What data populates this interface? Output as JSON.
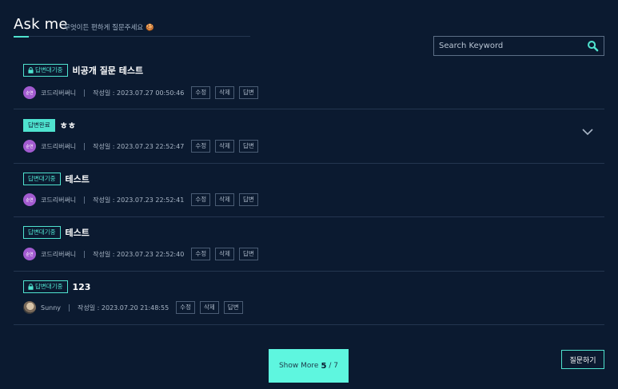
{
  "header": {
    "title": "Ask me",
    "subtitle": "무엇이든 편하게 질문주세요 🍪"
  },
  "search": {
    "placeholder": "Search Keyword"
  },
  "posts": [
    {
      "badge": "답변대기중",
      "locked": true,
      "title": "비공개 질문 테스트",
      "author": "코드리버써니",
      "avatar_text": "순연",
      "date": "작성일 : 2023.07.27 00:50:46",
      "actions": [
        "수정",
        "삭제",
        "답변"
      ]
    },
    {
      "badge": "답변완료",
      "locked": false,
      "title": "ㅎㅎ",
      "author": "코드리버써니",
      "avatar_text": "순연",
      "date": "작성일 : 2023.07.23 22:52:47",
      "actions": [
        "수정",
        "삭제",
        "답변"
      ],
      "expandable": true
    },
    {
      "badge": "답변대기중",
      "locked": false,
      "title": "테스트",
      "author": "코드리버써니",
      "avatar_text": "순연",
      "date": "작성일 : 2023.07.23 22:52:41",
      "actions": [
        "수정",
        "삭제",
        "답변"
      ]
    },
    {
      "badge": "답변대기중",
      "locked": false,
      "title": "테스트",
      "author": "코드리버써니",
      "avatar_text": "순연",
      "date": "작성일 : 2023.07.23 22:52:40",
      "actions": [
        "수정",
        "삭제",
        "답변"
      ]
    },
    {
      "badge": "답변대기중",
      "locked": true,
      "title": "123",
      "author": "Sunny",
      "avatar_text": "",
      "date": "작성일 : 2023.07.20 21:48:55",
      "actions": [
        "수정",
        "삭제",
        "답변"
      ]
    }
  ],
  "pagination": {
    "label": "Show More",
    "current": "5",
    "sep_total": "/ 7"
  },
  "ask_button": "질문하기",
  "colors": {
    "background": "#0b1a30",
    "accent": "#4fe3cf",
    "button": "#5ef6df",
    "avatar": "#a25bd0"
  }
}
